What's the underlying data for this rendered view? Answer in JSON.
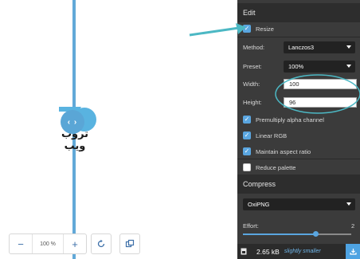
{
  "preview": {
    "logo_text": "تروب ويب",
    "divider_handle_glyph": "‹ ›",
    "zoom": {
      "minus": "−",
      "value": "100 %",
      "plus": "+"
    },
    "icons": [
      "rotate-icon",
      "background-toggle-icon"
    ]
  },
  "edit": {
    "title": "Edit",
    "resize": {
      "label": "Resize",
      "checked": true
    },
    "method": {
      "label": "Method:",
      "value": "Lanczos3"
    },
    "preset": {
      "label": "Preset:",
      "value": "100%"
    },
    "width": {
      "label": "Width:",
      "value": "100"
    },
    "height": {
      "label": "Height:",
      "value": "96"
    },
    "premultiply": {
      "label": "Premultiply alpha channel",
      "checked": true
    },
    "linear_rgb": {
      "label": "Linear RGB",
      "checked": true
    },
    "aspect": {
      "label": "Maintain aspect ratio",
      "checked": true
    },
    "reduce_palette": {
      "label": "Reduce palette",
      "checked": false
    }
  },
  "compress": {
    "title": "Compress",
    "codec": "OxiPNG",
    "effort": {
      "label": "Effort:",
      "value": "2",
      "fraction": 0.67
    }
  },
  "result": {
    "size": "2.65 kB",
    "note": "slightly smaller"
  },
  "colors": {
    "accent": "#5aa6e0",
    "annotation": "#4cb8c4",
    "panel": "#3b3b3b"
  }
}
